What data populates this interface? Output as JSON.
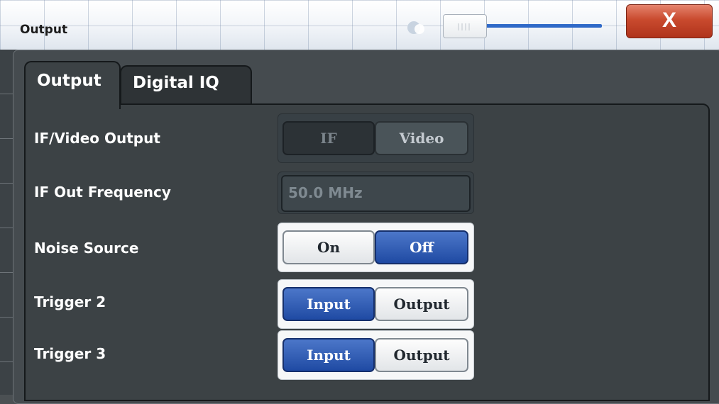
{
  "window": {
    "title": "Output",
    "close_label": "X"
  },
  "tabs": [
    {
      "label": "Output",
      "selected": true
    },
    {
      "label": "Digital IQ",
      "selected": false
    }
  ],
  "settings": {
    "if_video_output": {
      "label": "IF/Video Output",
      "options": [
        "IF",
        "Video"
      ],
      "selected": "IF",
      "enabled": false
    },
    "if_out_frequency": {
      "label": "IF Out Frequency",
      "value": "50.0 MHz",
      "enabled": false
    },
    "noise_source": {
      "label": "Noise Source",
      "options": [
        "On",
        "Off"
      ],
      "selected": "Off"
    },
    "trigger_2": {
      "label": "Trigger 2",
      "options": [
        "Input",
        "Output"
      ],
      "selected": "Input"
    },
    "trigger_3": {
      "label": "Trigger 3",
      "options": [
        "Input",
        "Output"
      ],
      "selected": "Input"
    }
  },
  "colors": {
    "accent_selected": "#2f5bb5",
    "close_button": "#c94a2e",
    "panel_background": "#3c4245"
  }
}
